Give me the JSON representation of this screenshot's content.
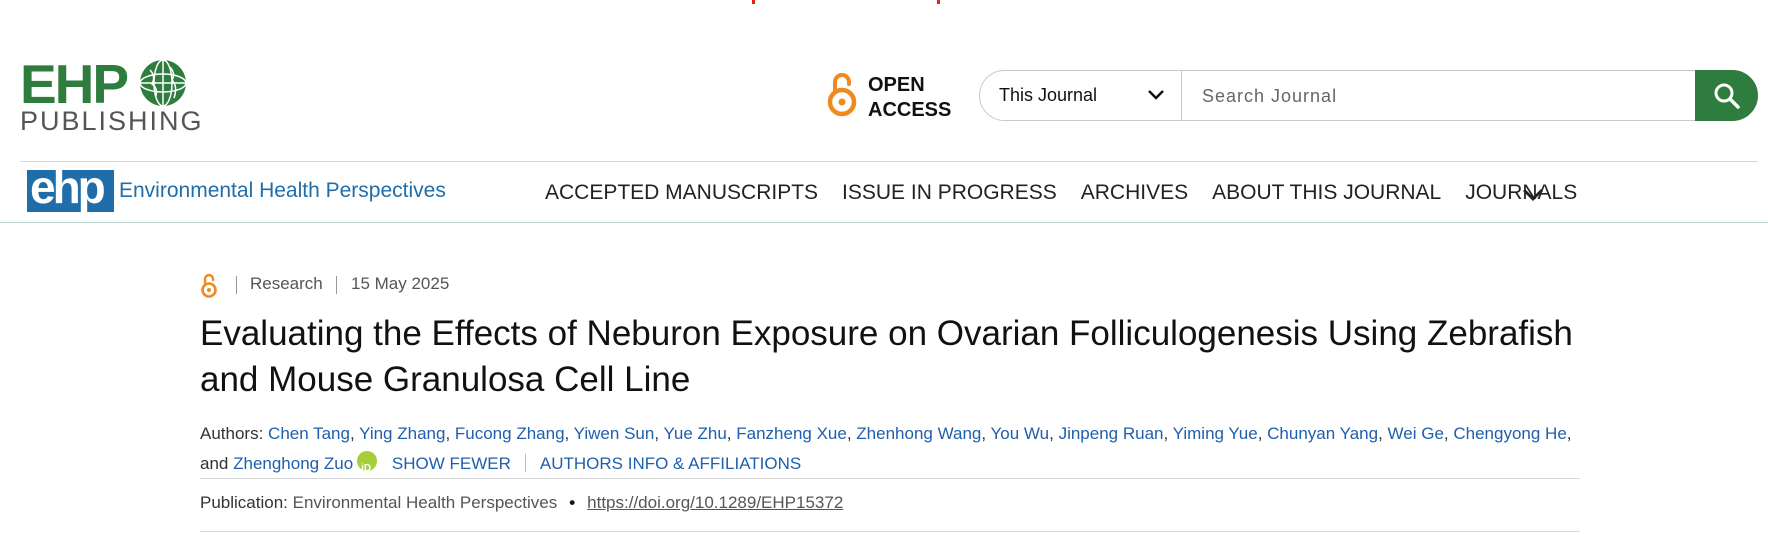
{
  "header": {
    "logo_ehp": "EHP",
    "logo_publishing": "PUBLISHING",
    "open_access_line1": "OPEN",
    "open_access_line2": "ACCESS",
    "search": {
      "scope_label": "This Journal",
      "placeholder": "Search Journal",
      "value": ""
    }
  },
  "nav": {
    "journal_logo_text": "ehp",
    "journal_name": "Environmental Health Perspectives",
    "items": [
      {
        "label": "ACCEPTED MANUSCRIPTS"
      },
      {
        "label": "ISSUE IN PROGRESS"
      },
      {
        "label": "ARCHIVES"
      },
      {
        "label": "ABOUT THIS JOURNAL"
      },
      {
        "label": "JOURNALS"
      }
    ]
  },
  "article": {
    "type": "Research",
    "date": "15 May 2025",
    "title": "Evaluating the Effects of Neburon Exposure on Ovarian Folliculogenesis Using Zebrafish and Mouse Granulosa Cell Line",
    "authors_label": "Authors:",
    "authors": [
      "Chen Tang",
      "Ying Zhang",
      "Fucong Zhang",
      "Yiwen Sun",
      "Yue Zhu",
      "Fanzheng Xue",
      "Zhenhong Wang",
      "You Wu",
      "Jinpeng Ruan",
      "Yiming Yue",
      "Chunyan Yang",
      "Wei Ge",
      "Chengyong He"
    ],
    "authors_and": ", and",
    "last_author": "Zhenghong Zuo",
    "orcid_label": "iD",
    "show_fewer": "SHOW FEWER",
    "authors_info": "AUTHORS INFO & AFFILIATIONS",
    "publication_label": "Publication:",
    "publication_journal": "Environmental Health Perspectives",
    "doi": "https://doi.org/10.1289/EHP15372"
  },
  "colors": {
    "brand_green": "#2e7d3e",
    "journal_blue": "#1f6ea9",
    "link_blue": "#1f5fad",
    "open_access_orange": "#f08a1f"
  }
}
